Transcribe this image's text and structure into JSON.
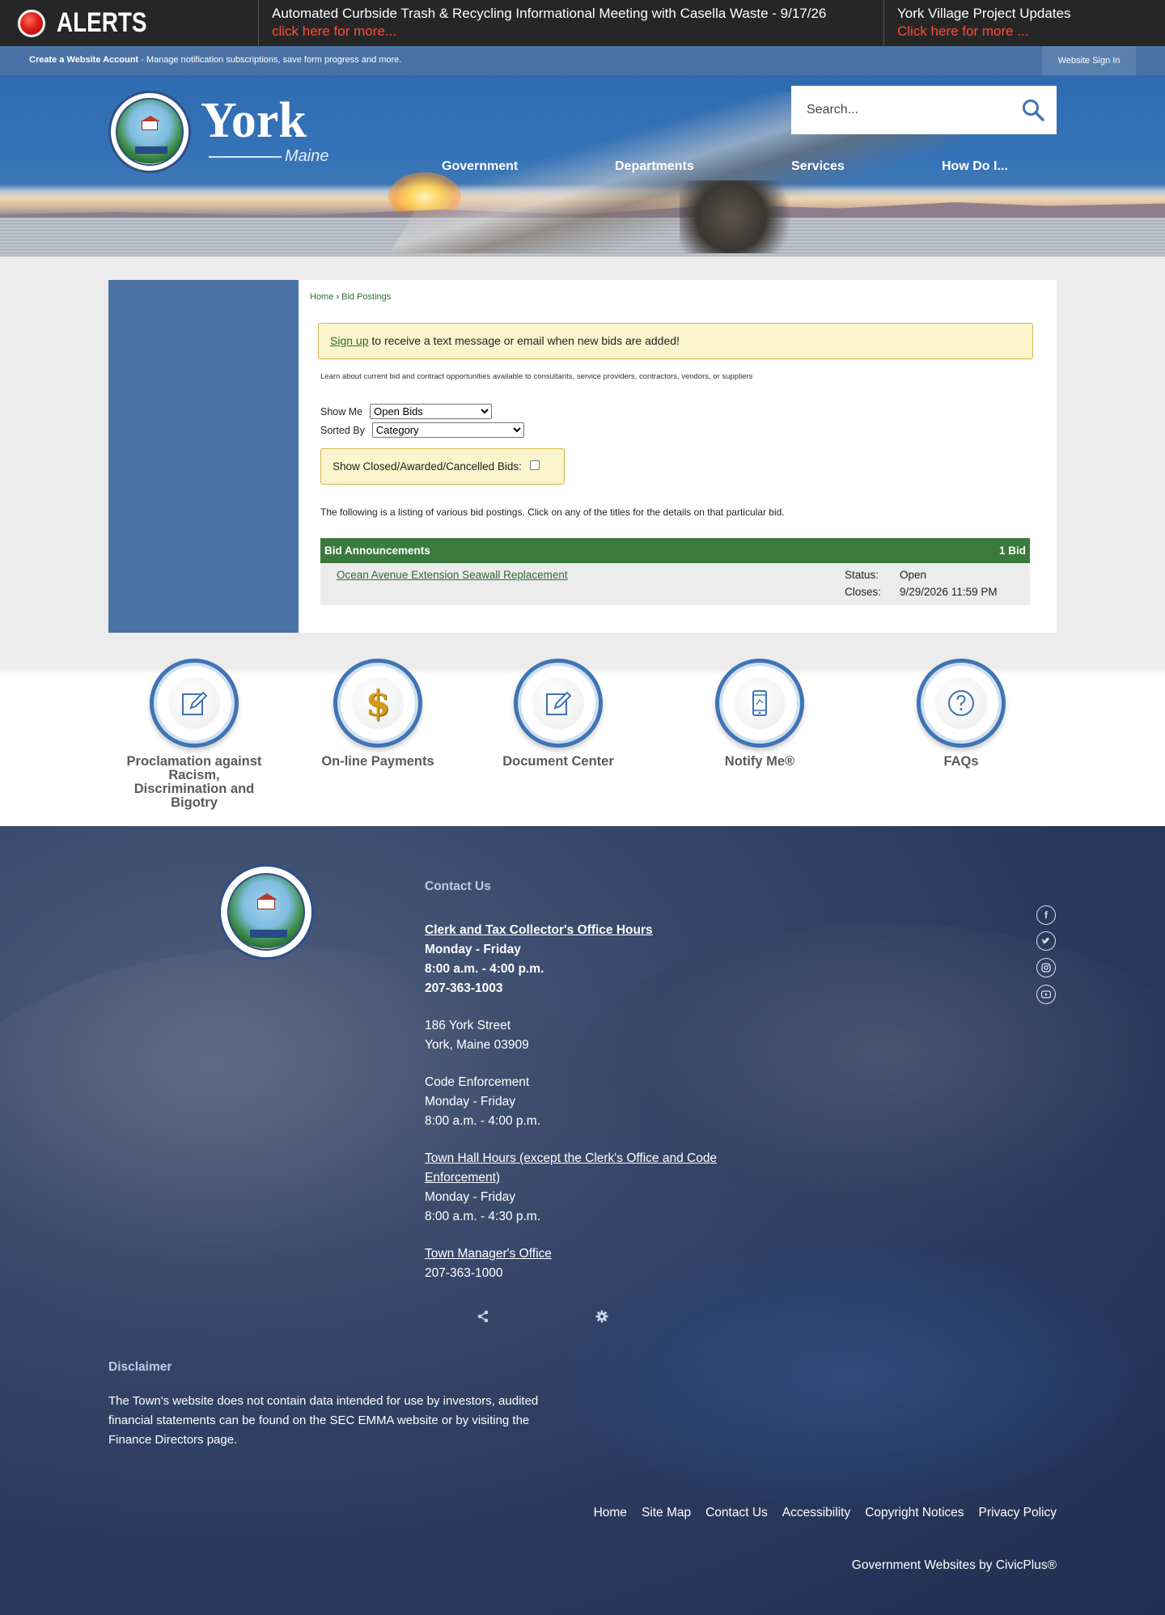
{
  "alerts": {
    "title": "ALERTS",
    "items": [
      {
        "text": "Automated Curbside Trash & Recycling Informational Meeting with Casella Waste - 9/17/26",
        "more": "click here for more..."
      },
      {
        "text": "York Village Project Updates",
        "more": "Click here for more ..."
      }
    ]
  },
  "account": {
    "create_label": "Create a Website Account",
    "description": " - Manage notification subscriptions, save form progress and more.",
    "signin_label": "Website Sign In"
  },
  "header": {
    "logo_word": "York",
    "logo_sub": "Maine",
    "search_placeholder": "Search...",
    "nav": [
      "Government",
      "Departments",
      "Services",
      "How Do I..."
    ]
  },
  "breadcrumb": {
    "home": "Home",
    "sep": " › ",
    "current": "Bid Postings"
  },
  "signup": {
    "link": "Sign up",
    "text": " to receive a text message or email when new bids are added!"
  },
  "intro": "Learn about current bid and contract opportunities available to consultants, service providers, contractors, vendors, or suppliers",
  "filters": {
    "show_me_label": "Show Me",
    "show_me_value": "Open Bids",
    "sorted_by_label": "Sorted By",
    "sorted_by_value": "Category",
    "closed_label": "Show Closed/Awarded/Cancelled Bids:"
  },
  "listing_text": "The following is a listing of various bid postings. Click on any of the titles for the details on that particular bid.",
  "bids": {
    "header": "Bid Announcements",
    "count": "1 Bid",
    "items": [
      {
        "title": "Ocean Avenue Extension Seawall Replacement",
        "status_label": "Status:",
        "status": "Open",
        "closes_label": "Closes:",
        "closes": "9/29/2026 11:59 PM"
      }
    ]
  },
  "quick_links": [
    {
      "label": "Proclamation against Racism, Discrimination and Bigotry",
      "icon": "document-edit-icon"
    },
    {
      "label": "On-line Payments",
      "icon": "dollar-icon"
    },
    {
      "label": "Document Center",
      "icon": "document-edit-icon"
    },
    {
      "label": "Notify Me®",
      "icon": "phone-icon"
    },
    {
      "label": "FAQs",
      "icon": "question-icon"
    }
  ],
  "footer": {
    "contact_head": "Contact Us",
    "clerk_title": "Clerk and Tax Collector's Office Hours",
    "clerk_days": "Monday - Friday",
    "clerk_hours": "8:00 a.m. - 4:00 p.m.",
    "clerk_phone": "207-363-1003",
    "address_1": "186 York Street",
    "address_2": "York, Maine 03909",
    "code_title": "Code Enforcement",
    "code_days": "Monday - Friday",
    "code_hours": "8:00 a.m. - 4:00 p.m.",
    "townhall_title": "Town Hall Hours (except the Clerk's Office and Code Enforcement)",
    "townhall_days": "Monday - Friday",
    "townhall_hours": "8:00 a.m. - 4:30 p.m.",
    "manager_title": "Town Manager's Office",
    "manager_phone": "207-363-1000",
    "disclaimer_head": "Disclaimer",
    "disclaimer_text": "The Town's website does not contain data intended for use by investors, audited financial statements can be found on the SEC EMMA website or by visiting the Finance Directors page.",
    "links": [
      "Home",
      "Site Map",
      "Contact Us",
      "Accessibility",
      "Copyright Notices",
      "Privacy Policy"
    ],
    "credit": "Government Websites by CivicPlus®"
  },
  "colors": {
    "alert_red": "#ff4b3a",
    "brand_blue": "#4a72a4",
    "bid_green": "#3a7a3c",
    "notice_yellow": "#fbf4cc"
  }
}
